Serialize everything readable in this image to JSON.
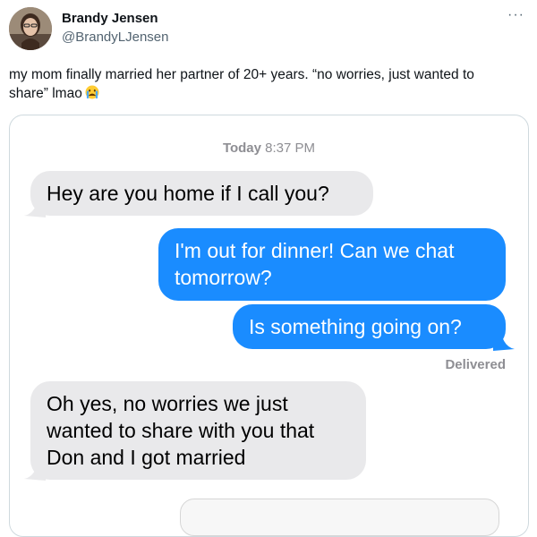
{
  "author": {
    "name": "Brandy Jensen",
    "handle": "@BrandyLJensen",
    "avatar_icon": "profile-photo-avatar"
  },
  "more_label": "···",
  "tweet": {
    "text": "my mom finally married her partner of 20+ years. “no worries, just wanted to share” lmao",
    "emoji_icon": "crying-face-emoji"
  },
  "screenshot": {
    "timestamp_day": "Today",
    "timestamp_time": "8:37 PM",
    "messages": [
      {
        "direction": "incoming",
        "text": "Hey are you home if I call you?"
      },
      {
        "direction": "outgoing",
        "text": "I'm out for dinner! Can we chat tomorrow?"
      },
      {
        "direction": "outgoing",
        "text": "Is something going on?"
      },
      {
        "direction": "incoming",
        "text": "Oh yes, no worries we just wanted to share with you that Don and I got married"
      }
    ],
    "delivered_label": "Delivered"
  },
  "colors": {
    "incoming_bubble": "#e9e9eb",
    "outgoing_bubble": "#1a8cff",
    "secondary_text": "#536471"
  }
}
